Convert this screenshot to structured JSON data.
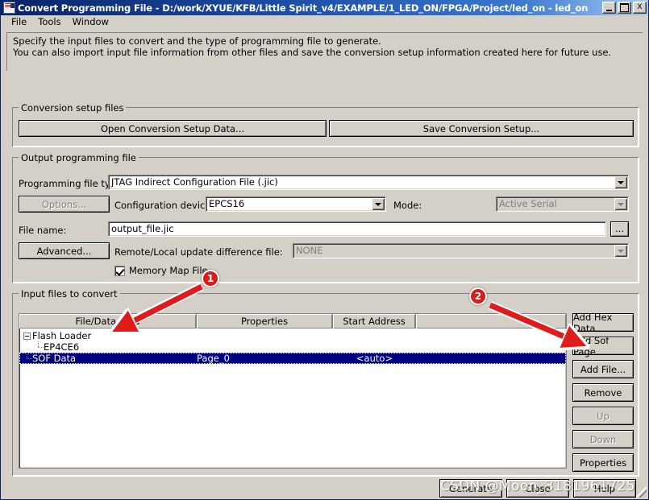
{
  "window": {
    "title": "Convert Programming File - D:/work/XYUE/KFB/Little Spirit_v4/EXAMPLE/1_LED_ON/FPGA/Project/led_on - led_on",
    "minimize_label": "_",
    "maximize_label": "□",
    "close_label": "X"
  },
  "menubar": {
    "items": [
      {
        "label": "File"
      },
      {
        "label": "Tools"
      },
      {
        "label": "Window"
      }
    ]
  },
  "description": "Specify the input files to convert and the type of programming file to generate.\nYou can also import input file information from other files and save the conversion setup information created here for future use.",
  "conversion_setup": {
    "legend": "Conversion setup files",
    "open_button": "Open Conversion Setup Data...",
    "save_button": "Save Conversion Setup..."
  },
  "output_programming_file": {
    "legend": "Output programming file",
    "programming_file_type_label": "Programming file type:",
    "programming_file_type_value": "JTAG Indirect Configuration File (.jic)",
    "options_button": "Options...",
    "configuration_device_label": "Configuration device:",
    "configuration_device_value": "EPCS16",
    "mode_label": "Mode:",
    "mode_value": "Active Serial",
    "file_name_label": "File name:",
    "file_name_value": "output_file.jic",
    "browse_button": "...",
    "advanced_button": "Advanced...",
    "remote_local_label": "Remote/Local update difference file:",
    "remote_local_value": "NONE",
    "memory_map_label": "Memory Map File",
    "memory_map_checked": true
  },
  "input_files": {
    "legend": "Input files to convert",
    "columns": [
      "File/Data area",
      "Properties",
      "Start Address"
    ],
    "rows": [
      {
        "file_data_area": "Flash Loader",
        "properties": "",
        "start_address": "",
        "level": 0,
        "twisty": "minus",
        "selected": false
      },
      {
        "file_data_area": "EP4CE6",
        "properties": "",
        "start_address": "",
        "level": 1,
        "twisty": "leaf",
        "selected": false
      },
      {
        "file_data_area": "SOF Data",
        "properties": "Page_0",
        "start_address": "<auto>",
        "level": 0,
        "twisty": "leaf",
        "selected": true
      }
    ],
    "side_buttons": [
      {
        "label": "Add Hex Data",
        "disabled": false
      },
      {
        "label": "Add Sof Page",
        "disabled": false
      },
      {
        "label": "Add File...",
        "disabled": false
      },
      {
        "label": "Remove",
        "disabled": false
      },
      {
        "label": "Up",
        "disabled": true
      },
      {
        "label": "Down",
        "disabled": true
      },
      {
        "label": "Properties",
        "disabled": false
      }
    ]
  },
  "footer": {
    "generate_button": "Generate",
    "close_button": "Close",
    "help_button": "Help"
  },
  "annotations": [
    {
      "number": "1"
    },
    {
      "number": "2"
    }
  ],
  "watermark": "CSDN @Moon_3181961725",
  "colors": {
    "face": "#d4d0c8",
    "title_active": "#0a246a",
    "selection": "#000080",
    "annotation": "#d91c1c"
  }
}
